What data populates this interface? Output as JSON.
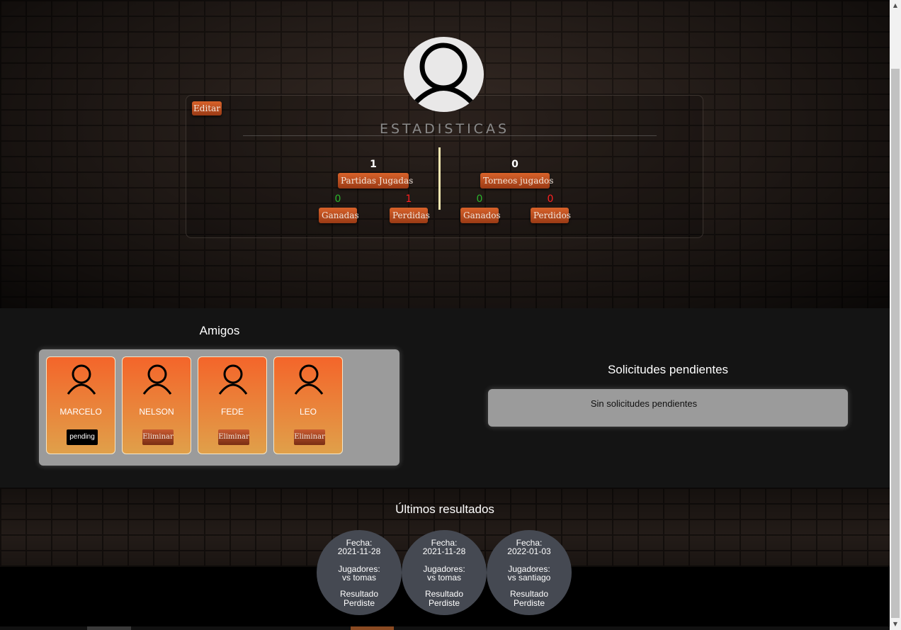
{
  "profile": {
    "edit_label": "Editar",
    "avatar_icon": "user-avatar-icon"
  },
  "stats": {
    "title": "ESTADISTICAS",
    "matches_played_value": "1",
    "matches_played_label": "Partidas Jugadas",
    "tournaments_played_value": "0",
    "tournaments_played_label": "Torneos jugados",
    "matches_won_value": "0",
    "matches_won_label": "Ganadas",
    "matches_lost_value": "1",
    "matches_lost_label": "Perdidas",
    "tournaments_won_value": "0",
    "tournaments_won_label": "Ganados",
    "tournaments_lost_value": "0",
    "tournaments_lost_label": "Perdidos",
    "colors": {
      "won": "#2bb52b",
      "lost": "#ff2222",
      "button": "#d8622a"
    }
  },
  "friends": {
    "title": "Amigos",
    "items": [
      {
        "name": "MARCELO",
        "action": "pending"
      },
      {
        "name": "NELSON",
        "action": "Eliminar"
      },
      {
        "name": "FEDE",
        "action": "Eliminar"
      },
      {
        "name": "LEO",
        "action": "Eliminar"
      }
    ]
  },
  "requests": {
    "title": "Solicitudes pendientes",
    "empty_text": "Sin solicitudes pendientes"
  },
  "results": {
    "title": "Últimos resultados",
    "items": [
      {
        "date_label": "Fecha:",
        "date": "2021-11-28",
        "players_label": "Jugadores:",
        "players": "vs tomas",
        "result_label": "Resultado",
        "result": "Perdiste"
      },
      {
        "date_label": "Fecha:",
        "date": "2021-11-28",
        "players_label": "Jugadores:",
        "players": "vs tomas",
        "result_label": "Resultado",
        "result": "Perdiste"
      },
      {
        "date_label": "Fecha:",
        "date": "2022-01-03",
        "players_label": "Jugadores:",
        "players": "vs santiago",
        "result_label": "Resultado",
        "result": "Perdiste"
      }
    ]
  }
}
